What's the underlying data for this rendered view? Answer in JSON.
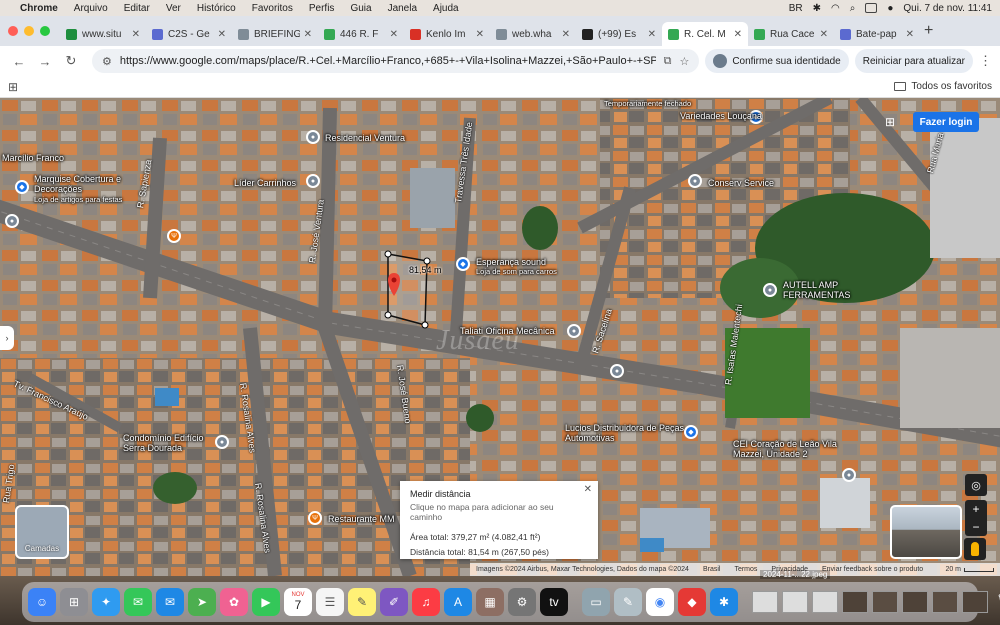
{
  "menubar": {
    "app": "Chrome",
    "items": [
      "Arquivo",
      "Editar",
      "Ver",
      "Histórico",
      "Favoritos",
      "Perfis",
      "Guia",
      "Janela",
      "Ajuda"
    ],
    "input_lang": "BR",
    "clock": "Qui. 7 de nov.  11:41"
  },
  "tabs": [
    {
      "label": "www.situ",
      "color": "#1e8e3e"
    },
    {
      "label": "C2S - Ge",
      "color": "#5b6ad0"
    },
    {
      "label": "BRIEFING",
      "color": "#7f8c97"
    },
    {
      "label": "446 R. F",
      "color": "#34a853"
    },
    {
      "label": "Kenlo Im",
      "color": "#d93025"
    },
    {
      "label": "web.wha",
      "color": "#7f8c97"
    },
    {
      "label": "(+99) Es",
      "color": "#222222"
    },
    {
      "label": "R. Cel. M",
      "color": "#34a853"
    },
    {
      "label": "Rua Cace",
      "color": "#34a853"
    },
    {
      "label": "Bate-pap",
      "color": "#5b6ad0"
    }
  ],
  "active_tab_index": 7,
  "toolbar": {
    "url": "https://www.google.com/maps/place/R.+Cel.+Marcílio+Franco,+685+-+Vila+Isolina+Mazzei,+São+Paulo+-+SP,+02079-0...",
    "identity_label": "Confirme sua identidade",
    "restart_label": "Reiniciar para atualizar"
  },
  "bookmarks": {
    "all_label": "Todos os favoritos"
  },
  "map": {
    "login_label": "Fazer login",
    "layers_label": "Camadas",
    "watermark": "Jusaeu",
    "places": [
      {
        "name": "Residencial Ventura",
        "kind": "landmark"
      },
      {
        "name": "Variedades Louçana",
        "kind": "shop"
      },
      {
        "name": "Marcílio Franco",
        "kind": "street"
      },
      {
        "name": "Marquise Cobertura e Decorações",
        "kind": "shop"
      },
      {
        "name": "Loja de artigos para festas",
        "kind": "sub"
      },
      {
        "name": "Líder Carrinhos",
        "kind": "landmark"
      },
      {
        "name": "Conserv Service",
        "kind": "landmark"
      },
      {
        "name": "Esperança sound",
        "kind": "shop"
      },
      {
        "name": "Loja de som para carros",
        "kind": "sub"
      },
      {
        "name": "AUTELL AMP FERRAMENTAS",
        "kind": "landmark"
      },
      {
        "name": "Taliati Oficina Mecânica",
        "kind": "landmark"
      },
      {
        "name": "Condomínio Edifício Serra Dourada",
        "kind": "landmark"
      },
      {
        "name": "Lucios Distribuidora de Peças Automotivas",
        "kind": "shop"
      },
      {
        "name": "CEI Coração de Leão Vila Mazzei, Unidade 2",
        "kind": "landmark"
      },
      {
        "name": "Restaurante MM",
        "kind": "food"
      },
      {
        "name": "Temporariamente fechado",
        "kind": "sub"
      }
    ],
    "streets": [
      "R. Sapienza",
      "R. José Ventura",
      "Travessa Três Idade",
      "R. Sacelina",
      "R. Rosalina Alves",
      "R. José Bueno",
      "Tv. Francisco Araújo",
      "R. Isaías Malentechi",
      "Rua Maria",
      "R. Rosalina Alves",
      "Rua Trigo"
    ],
    "measurement_label": "81,54 m",
    "measure_panel": {
      "title": "Medir distância",
      "hint": "Clique no mapa para adicionar ao seu caminho",
      "area": "Área total: 379,27 m² (4.082,41 ft²)",
      "distance": "Distância total: 81,54 m (267,50 pés)"
    },
    "attribution": {
      "imagery": "Imagens ©2024 Airbus, Maxar Technologies, Dados do mapa ©2024",
      "country": "Brasil",
      "terms": "Termos",
      "privacy": "Privacidade",
      "feedback": "Enviar feedback sobre o produto",
      "scale": "20 m"
    }
  },
  "dock": {
    "file_label": "2024-11-...22.jpeg",
    "calendar_month": "NOV",
    "calendar_day": "7"
  }
}
